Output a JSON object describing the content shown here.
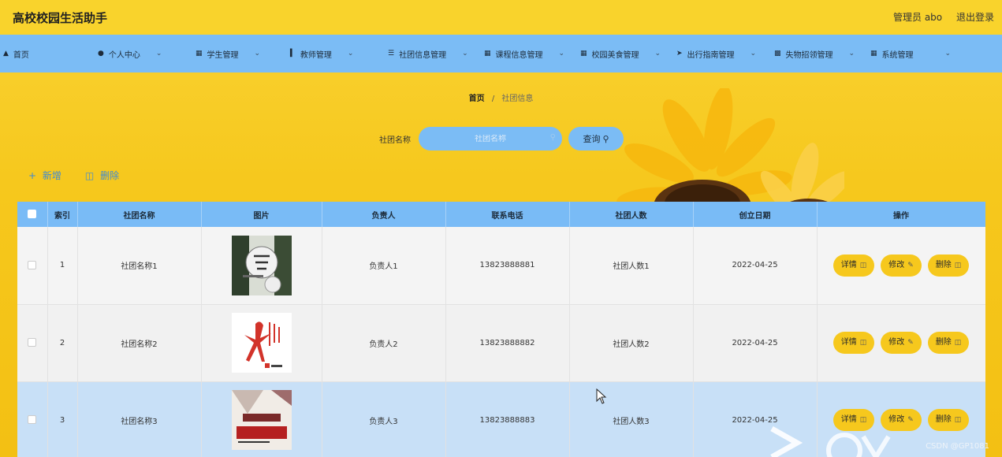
{
  "header": {
    "title": "高校校园生活助手",
    "admin_label": "管理员 abo",
    "logout_label": "退出登录"
  },
  "nav": {
    "items": [
      {
        "label": "首页",
        "icon": "home-icon"
      },
      {
        "label": "个人中心",
        "icon": "user-icon"
      },
      {
        "label": "学生管理",
        "icon": "grid-icon"
      },
      {
        "label": "教师管理",
        "icon": "bar-chart-icon"
      },
      {
        "label": "社团信息管理",
        "icon": "list-icon"
      },
      {
        "label": "课程信息管理",
        "icon": "grid-icon"
      },
      {
        "label": "校园美食管理",
        "icon": "grid-icon"
      },
      {
        "label": "出行指南管理",
        "icon": "send-icon"
      },
      {
        "label": "失物招领管理",
        "icon": "clipboard-icon"
      },
      {
        "label": "系统管理",
        "icon": "grid-icon"
      }
    ]
  },
  "breadcrumb": {
    "home": "首页",
    "separator": "/",
    "current": "社团信息"
  },
  "search": {
    "label": "社团名称",
    "placeholder": "社团名称",
    "button_label": "查询"
  },
  "actions": {
    "add_label": "新增",
    "delete_label": "删除"
  },
  "table": {
    "columns": [
      "索引",
      "社团名称",
      "图片",
      "负责人",
      "联系电话",
      "社团人数",
      "创立日期",
      "操作"
    ],
    "rows": [
      {
        "index": "1",
        "name": "社团名称1",
        "image": "football-poster",
        "leader": "负责人1",
        "phone": "13823888881",
        "members": "社团人数1",
        "date": "2022-04-25"
      },
      {
        "index": "2",
        "name": "社团名称2",
        "image": "dance-poster",
        "leader": "负责人2",
        "phone": "13823888882",
        "members": "社团人数2",
        "date": "2022-04-25"
      },
      {
        "index": "3",
        "name": "社团名称3",
        "image": "recruit-poster",
        "leader": "负责人3",
        "phone": "13823888883",
        "members": "社团人数3",
        "date": "2022-04-25"
      }
    ],
    "op_labels": {
      "detail": "详情",
      "edit": "修改",
      "delete": "删除"
    }
  },
  "watermark": "CSDN @GP1081",
  "colors": {
    "primary_yellow": "#f6c81d",
    "nav_blue": "#7bbcf5",
    "link_blue": "#3f8ad4"
  }
}
